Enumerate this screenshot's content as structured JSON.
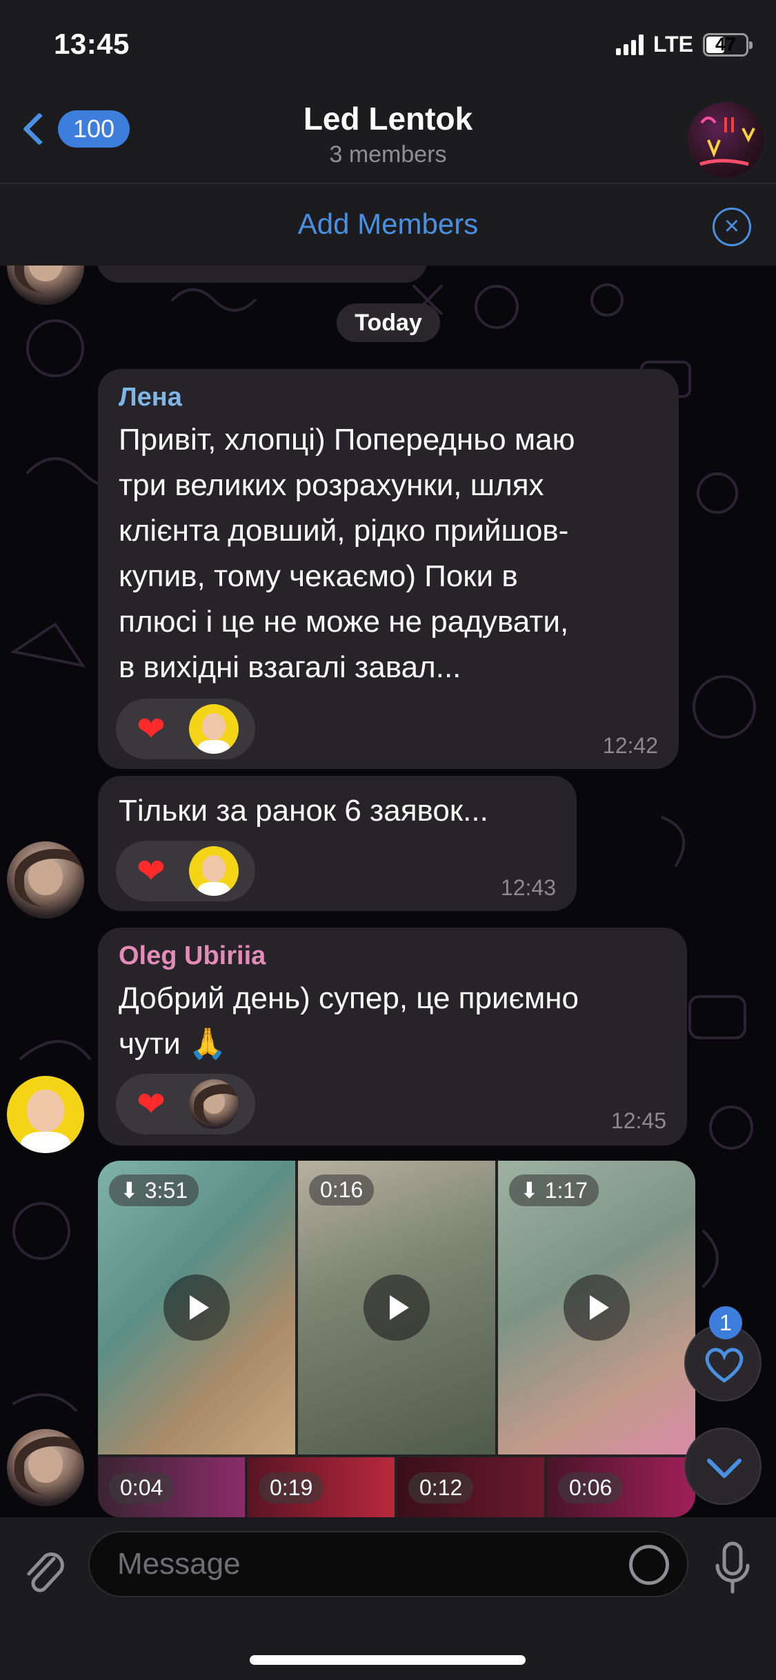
{
  "status_bar": {
    "time": "13:45",
    "network": "LTE",
    "battery": "47"
  },
  "header": {
    "back_count": "100",
    "title": "Led Lentok",
    "subtitle": "3 members",
    "add_members": "Add Members"
  },
  "chat": {
    "day_separator": "Today",
    "messages": [
      {
        "sender": "Лена",
        "sender_color": "#7fb6e6",
        "lines": [
          "Привіт, хлопці) Попередньо маю",
          "три великих розрахунки, шлях",
          "клієнта довший, рідко прийшов-",
          "купив, тому чекаємо) Поки в",
          "плюсі і це не може не радувати,",
          "в вихідні взагалі завал..."
        ],
        "time": "12:42",
        "reaction": "❤"
      },
      {
        "lines": [
          "Тільки за ранок 6 заявок..."
        ],
        "time": "12:43",
        "reaction": "❤"
      },
      {
        "sender": "Oleg Ubiriia",
        "sender_color": "#e58bb8",
        "lines": [
          "Добрий день) супер, це приємно",
          "чути 🙏"
        ],
        "time": "12:45",
        "reaction": "❤"
      }
    ],
    "media_album": {
      "videos": [
        {
          "duration": "3:51",
          "download": true
        },
        {
          "duration": "0:16",
          "download": false
        },
        {
          "duration": "1:17",
          "download": true
        },
        {
          "duration": "0:04"
        },
        {
          "duration": "0:19"
        },
        {
          "duration": "0:12"
        },
        {
          "duration": "0:06"
        }
      ]
    },
    "unread_reactions": "1"
  },
  "composer": {
    "placeholder": "Message"
  }
}
